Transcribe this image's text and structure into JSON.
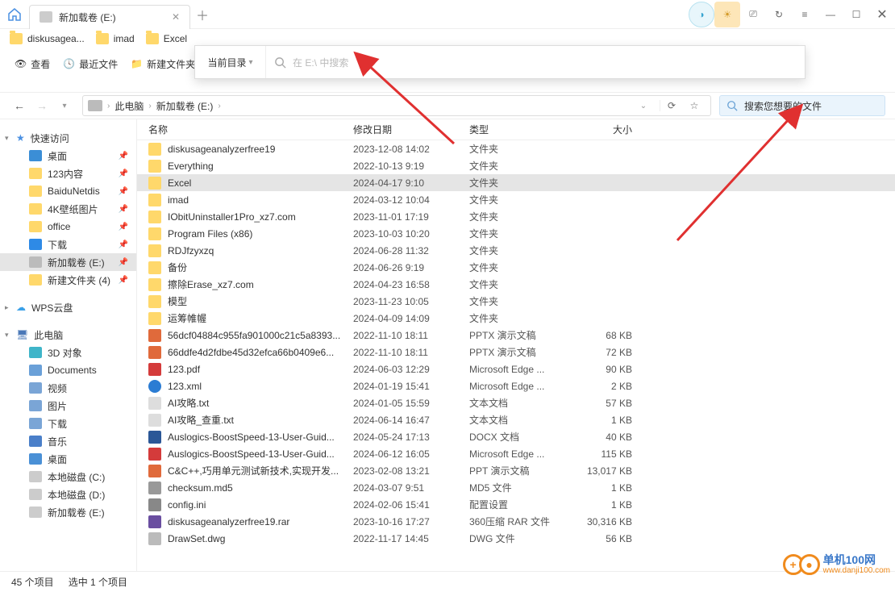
{
  "titlebar": {
    "tab_title": "新加载卷 (E:)",
    "buttons": {
      "ext": "⇪",
      "back": "↺",
      "menu": "≡",
      "min": "—",
      "max": "☐",
      "close": "✕"
    }
  },
  "breadcrumbs": [
    {
      "label": "diskusagea..."
    },
    {
      "label": "imad"
    },
    {
      "label": "Excel"
    }
  ],
  "toolbar": {
    "view": "查看",
    "recent": "最近文件",
    "newfolder": "新建文件夹"
  },
  "dropdown": {
    "scope": "当前目录",
    "placeholder": "在 E:\\ 中搜索"
  },
  "nav": {
    "path": [
      "此电脑",
      "新加载卷 (E:)"
    ],
    "search_placeholder": "搜索您想要的文件"
  },
  "sidebar": {
    "quick": "快速访问",
    "quick_items": [
      {
        "label": "桌面",
        "cls": "ico-desktop",
        "color": "#3b8ed6"
      },
      {
        "label": "123内容",
        "cls": "folder",
        "color": "#ffd86b"
      },
      {
        "label": "BaiduNetdis",
        "cls": "folder",
        "color": "#ffd86b"
      },
      {
        "label": "4K壁纸图片",
        "cls": "folder",
        "color": "#ffd86b"
      },
      {
        "label": "office",
        "cls": "folder",
        "color": "#ffd86b"
      },
      {
        "label": "下载",
        "cls": "download",
        "color": "#2e8ae6"
      },
      {
        "label": "新加载卷 (E:)",
        "cls": "drive",
        "color": "#bbb",
        "sel": true
      },
      {
        "label": "新建文件夹 (4)",
        "cls": "folder",
        "color": "#ffd86b"
      }
    ],
    "wps": "WPS云盘",
    "pc": "此电脑",
    "pc_items": [
      {
        "label": "3D 对象",
        "color": "#3fb5c9"
      },
      {
        "label": "Documents",
        "color": "#6aa0d8"
      },
      {
        "label": "视频",
        "color": "#7aa5d6"
      },
      {
        "label": "图片",
        "color": "#7aa5d6"
      },
      {
        "label": "下载",
        "color": "#7aa5d6"
      },
      {
        "label": "音乐",
        "color": "#4a7fc9"
      },
      {
        "label": "桌面",
        "color": "#4a90d6"
      },
      {
        "label": "本地磁盘 (C:)",
        "color": "#ccc"
      },
      {
        "label": "本地磁盘 (D:)",
        "color": "#ccc"
      },
      {
        "label": "新加载卷 (E:)",
        "color": "#ccc"
      }
    ]
  },
  "columns": {
    "name": "名称",
    "date": "修改日期",
    "type": "类型",
    "size": "大小"
  },
  "files": [
    {
      "name": "diskusageanalyzerfree19",
      "date": "2023-12-08 14:02",
      "type": "文件夹",
      "size": "",
      "ico": "ico-folder"
    },
    {
      "name": "Everything",
      "date": "2022-10-13 9:19",
      "type": "文件夹",
      "size": "",
      "ico": "ico-folder"
    },
    {
      "name": "Excel",
      "date": "2024-04-17 9:10",
      "type": "文件夹",
      "size": "",
      "ico": "ico-folder",
      "sel": true
    },
    {
      "name": "imad",
      "date": "2024-03-12 10:04",
      "type": "文件夹",
      "size": "",
      "ico": "ico-folder"
    },
    {
      "name": "IObitUninstaller1Pro_xz7.com",
      "date": "2023-11-01 17:19",
      "type": "文件夹",
      "size": "",
      "ico": "ico-folder"
    },
    {
      "name": "Program Files (x86)",
      "date": "2023-10-03 10:20",
      "type": "文件夹",
      "size": "",
      "ico": "ico-folder"
    },
    {
      "name": "RDJfzyxzq",
      "date": "2024-06-28 11:32",
      "type": "文件夹",
      "size": "",
      "ico": "ico-folder"
    },
    {
      "name": "备份",
      "date": "2024-06-26 9:19",
      "type": "文件夹",
      "size": "",
      "ico": "ico-folder"
    },
    {
      "name": "擦除Erase_xz7.com",
      "date": "2024-04-23 16:58",
      "type": "文件夹",
      "size": "",
      "ico": "ico-folder"
    },
    {
      "name": "模型",
      "date": "2023-11-23 10:05",
      "type": "文件夹",
      "size": "",
      "ico": "ico-folder"
    },
    {
      "name": "运筹帷幄",
      "date": "2024-04-09 14:09",
      "type": "文件夹",
      "size": "",
      "ico": "ico-folder"
    },
    {
      "name": "56dcf04884c955fa901000c21c5a8393...",
      "date": "2022-11-10 18:11",
      "type": "PPTX 演示文稿",
      "size": "68 KB",
      "ico": "ico-pptx"
    },
    {
      "name": "66ddfe4d2fdbe45d32efca66b0409e6...",
      "date": "2022-11-10 18:11",
      "type": "PPTX 演示文稿",
      "size": "72 KB",
      "ico": "ico-pptx"
    },
    {
      "name": "123.pdf",
      "date": "2024-06-03 12:29",
      "type": "Microsoft Edge ...",
      "size": "90 KB",
      "ico": "ico-pdf"
    },
    {
      "name": "123.xml",
      "date": "2024-01-19 15:41",
      "type": "Microsoft Edge ...",
      "size": "2 KB",
      "ico": "ico-edge"
    },
    {
      "name": "AI攻略.txt",
      "date": "2024-01-05 15:59",
      "type": "文本文档",
      "size": "57 KB",
      "ico": "ico-txt"
    },
    {
      "name": "AI攻略_查重.txt",
      "date": "2024-06-14 16:47",
      "type": "文本文档",
      "size": "1 KB",
      "ico": "ico-txt"
    },
    {
      "name": "Auslogics-BoostSpeed-13-User-Guid...",
      "date": "2024-05-24 17:13",
      "type": "DOCX 文档",
      "size": "40 KB",
      "ico": "ico-docx"
    },
    {
      "name": "Auslogics-BoostSpeed-13-User-Guid...",
      "date": "2024-06-12 16:05",
      "type": "Microsoft Edge ...",
      "size": "115 KB",
      "ico": "ico-pdf"
    },
    {
      "name": "C&C++,巧用单元测试新技术,实现开发...",
      "date": "2023-02-08 13:21",
      "type": "PPT 演示文稿",
      "size": "13,017 KB",
      "ico": "ico-pptx"
    },
    {
      "name": "checksum.md5",
      "date": "2024-03-07 9:51",
      "type": "MD5 文件",
      "size": "1 KB",
      "ico": "ico-md5"
    },
    {
      "name": "config.ini",
      "date": "2024-02-06 15:41",
      "type": "配置设置",
      "size": "1 KB",
      "ico": "ico-ini"
    },
    {
      "name": "diskusageanalyzerfree19.rar",
      "date": "2023-10-16 17:27",
      "type": "360压缩 RAR 文件",
      "size": "30,316 KB",
      "ico": "ico-rar"
    },
    {
      "name": "DrawSet.dwg",
      "date": "2022-11-17 14:45",
      "type": "DWG 文件",
      "size": "56 KB",
      "ico": "ico-dwg"
    }
  ],
  "status": {
    "count": "45 个项目",
    "selected": "选中 1 个项目"
  },
  "watermark": {
    "line1": "单机100网",
    "line2": "www.danji100.com"
  }
}
